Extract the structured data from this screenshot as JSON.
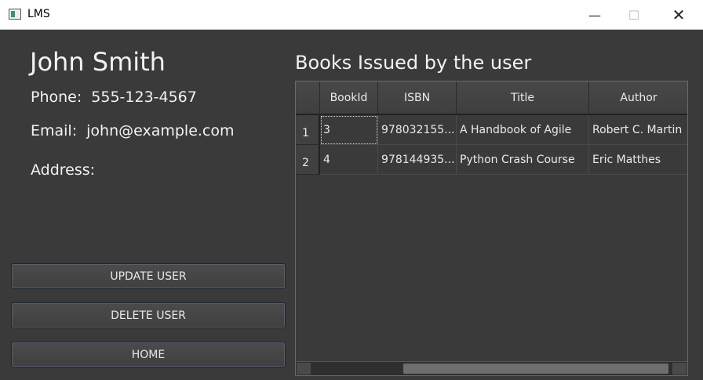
{
  "window": {
    "title": "LMS",
    "minimize": "—",
    "maximize": "☐",
    "close": "✕"
  },
  "user": {
    "name": "John Smith",
    "phone_label": "Phone:",
    "phone": "555-123-4567",
    "email_label": "Email:",
    "email": "john@example.com",
    "address_label": "Address:",
    "address": ""
  },
  "buttons": {
    "update": "UPDATE USER",
    "delete": "DELETE USER",
    "home": "HOME"
  },
  "table": {
    "title": "Books Issued by the user",
    "columns": [
      "BookId",
      "ISBN",
      "Title",
      "Author"
    ],
    "rows": [
      {
        "num": "1",
        "bookid": "3",
        "isbn": "978032155...",
        "title": "A Handbook of Agile",
        "author": "Robert C. Martin"
      },
      {
        "num": "2",
        "bookid": "4",
        "isbn": "978144935...",
        "title": "Python Crash Course",
        "author": "Eric Matthes"
      }
    ]
  }
}
